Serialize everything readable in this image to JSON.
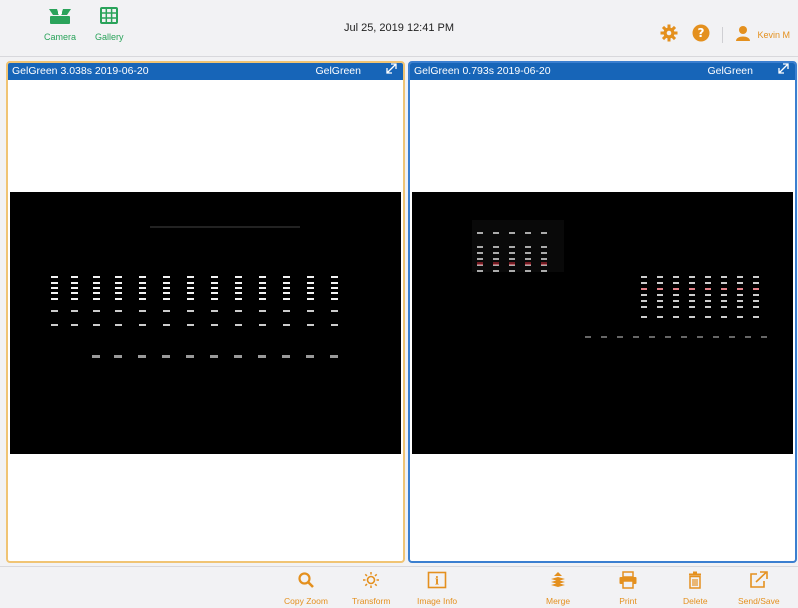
{
  "header": {
    "camera_label": "Camera",
    "gallery_label": "Gallery",
    "datetime": "Jul 25, 2019  12:41 PM",
    "user_name": "Kevin M"
  },
  "panels": [
    {
      "title": "GelGreen 3.038s 2019-06-20",
      "dye": "GelGreen"
    },
    {
      "title": "GelGreen 0.793s 2019-06-20",
      "dye": "GelGreen"
    }
  ],
  "toolbar": {
    "copy_zoom": "Copy Zoom",
    "transform": "Transform",
    "image_info": "Image Info",
    "merge": "Merge",
    "print": "Print",
    "delete": "Delete",
    "send_save": "Send/Save"
  },
  "colors": {
    "accent_orange": "#e4901e",
    "nav_green": "#2aa35a",
    "header_blue": "#1765b8",
    "selected_left_border": "#f0c474",
    "selected_right_border": "#3b7fd0"
  },
  "icons": {
    "camera": "camera-icon",
    "gallery": "gallery-icon",
    "settings": "gear-icon",
    "help": "help-icon",
    "user": "user-icon",
    "expand": "expand-icon",
    "copy_zoom": "magnifier-icon",
    "transform": "sun-icon",
    "image_info": "info-icon",
    "merge": "stack-icon",
    "print": "printer-icon",
    "delete": "trash-icon",
    "send_save": "share-icon"
  }
}
